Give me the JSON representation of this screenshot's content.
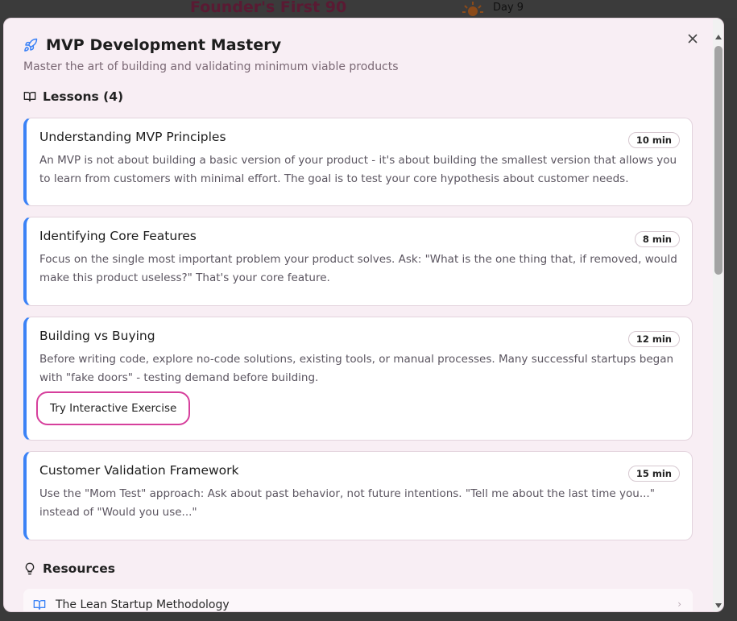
{
  "background": {
    "title": "Founder's First 90",
    "day_label": "Day 9"
  },
  "modal": {
    "title": "MVP Development Mastery",
    "subtitle": "Master the art of building and validating minimum viable products",
    "close_label": "×",
    "icon": "rocket-icon",
    "lessons_heading": "Lessons (4)",
    "resources_heading": "Resources",
    "accent_color": "#3b82f6",
    "exercise_border_color": "#d63f9c"
  },
  "lessons": [
    {
      "title": "Understanding MVP Principles",
      "duration": "10 min",
      "description": "An MVP is not about building a basic version of your product - it's about building the smallest version that allows you to learn from customers with minimal effort. The goal is to test your core hypothesis about customer needs."
    },
    {
      "title": "Identifying Core Features",
      "duration": "8 min",
      "description": "Focus on the single most important problem your product solves. Ask: \"What is the one thing that, if removed, would make this product useless?\" That's your core feature."
    },
    {
      "title": "Building vs Buying",
      "duration": "12 min",
      "description": "Before writing code, explore no-code solutions, existing tools, or manual processes. Many successful startups began with \"fake doors\" - testing demand before building.",
      "exercise_label": "Try Interactive Exercise"
    },
    {
      "title": "Customer Validation Framework",
      "duration": "15 min",
      "description": "Use the \"Mom Test\" approach: Ask about past behavior, not future intentions. \"Tell me about the last time you...\" instead of \"Would you use...\""
    }
  ],
  "resources": [
    {
      "label": "The Lean Startup Methodology",
      "icon": "book-icon"
    }
  ]
}
